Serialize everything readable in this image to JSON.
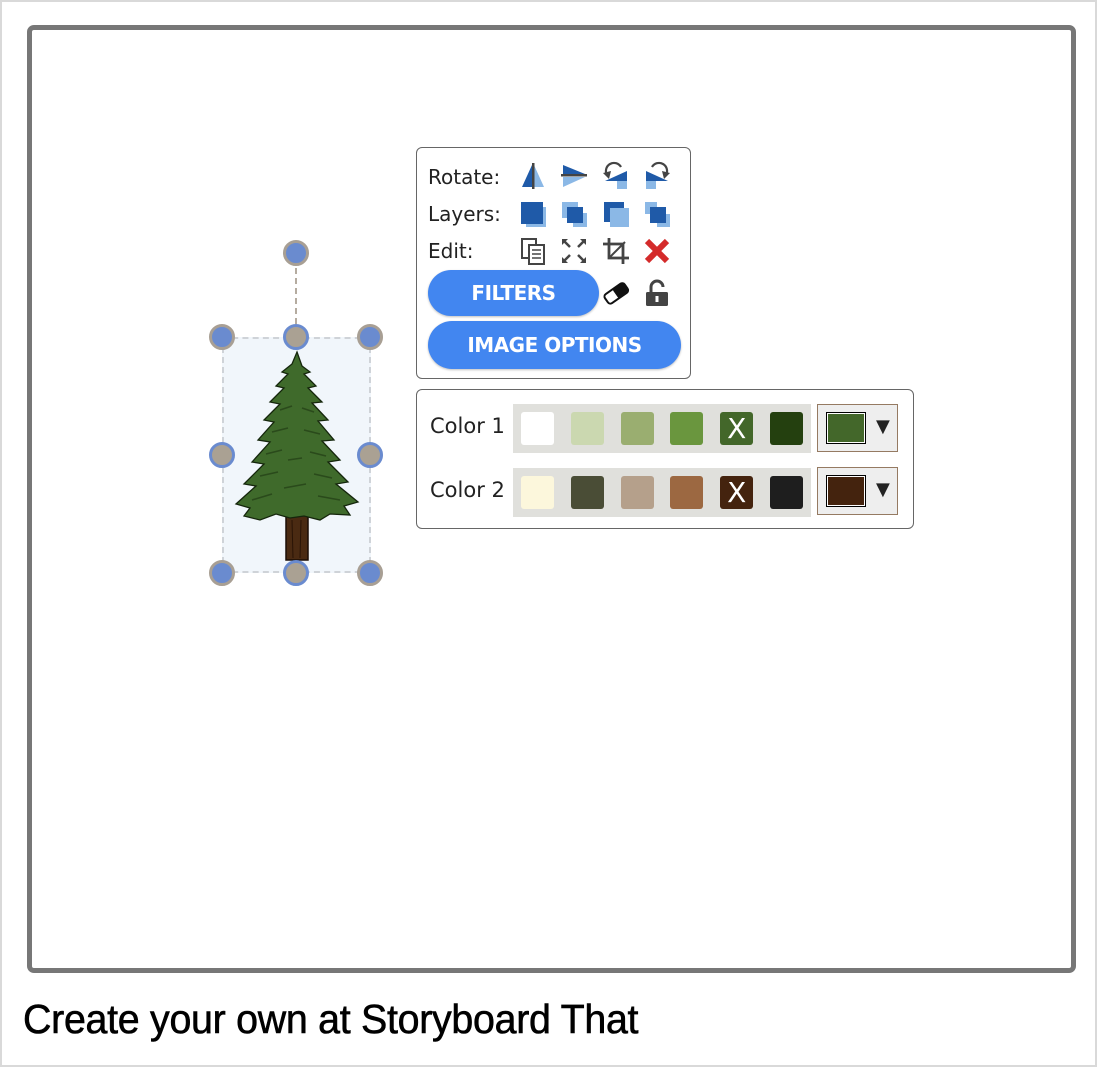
{
  "footer": {
    "text": "Create your own at Storyboard That"
  },
  "toolbox": {
    "rows": [
      {
        "label": "Rotate:",
        "icons": [
          "flip-horizontal-icon",
          "flip-vertical-icon",
          "rotate-left-icon",
          "rotate-right-icon"
        ]
      },
      {
        "label": "Layers:",
        "icons": [
          "bring-to-front-icon",
          "bring-forward-icon",
          "send-backward-icon",
          "send-to-back-icon"
        ]
      },
      {
        "label": "Edit:",
        "icons": [
          "copy-icon",
          "fullscreen-icon",
          "crop-icon",
          "delete-icon"
        ]
      }
    ],
    "filters_label": "FILTERS",
    "image_options_label": "IMAGE OPTIONS",
    "eraser_icon": "eraser-icon",
    "lock_icon": "unlock-icon"
  },
  "colors": {
    "color1": {
      "label": "Color 1",
      "swatches": [
        "#ffffff",
        "#cbd8b0",
        "#9aae70",
        "#6a963e",
        "#43672a",
        "#24400f"
      ],
      "selected_index": 4,
      "selected_mark": "X",
      "current": "#43672a"
    },
    "color2": {
      "label": "Color 2",
      "swatches": [
        "#fcf7dc",
        "#4a4d36",
        "#b5a08b",
        "#9c6841",
        "#44230e",
        "#1e1e1e"
      ],
      "selected_index": 4,
      "selected_mark": "X",
      "current": "#44230e"
    },
    "dropdown_arrow": "▼"
  },
  "accent": "#4286f0"
}
